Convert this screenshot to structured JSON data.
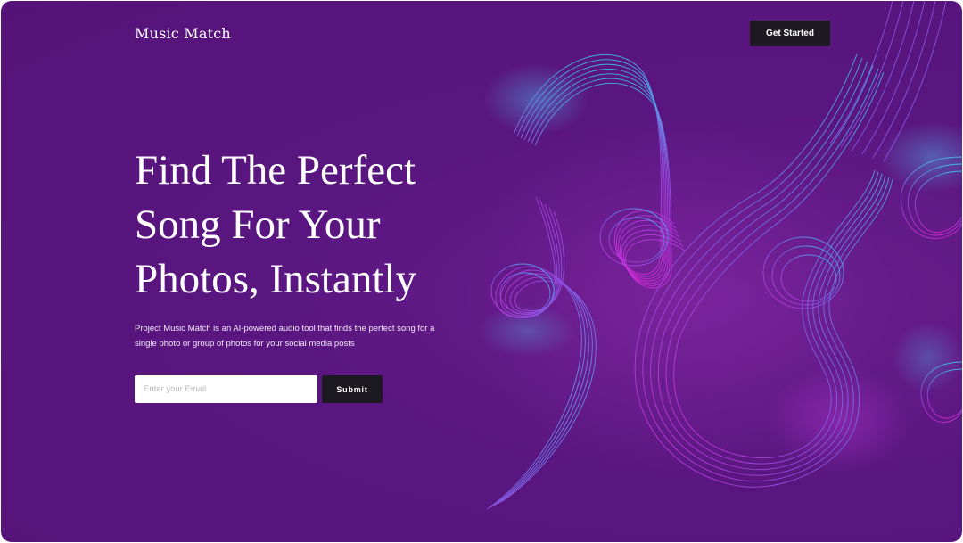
{
  "header": {
    "logo": "Music Match",
    "cta_label": "Get Started"
  },
  "hero": {
    "title": "Find The Perfect Song For Your Photos, Instantly",
    "description": "Project Music Match is an AI-powered audio tool that finds the perfect song for a single photo or group of photos for your social media posts"
  },
  "signup": {
    "email_placeholder": "Enter your Email",
    "email_value": "",
    "submit_label": "Submit"
  },
  "theme": {
    "background": "#5a1680",
    "button": "#1c1a20",
    "wave_cyan": "#3fc1f0",
    "wave_magenta": "#d42bd9"
  },
  "art": {
    "icon": "guitar-waveform-illustration"
  }
}
